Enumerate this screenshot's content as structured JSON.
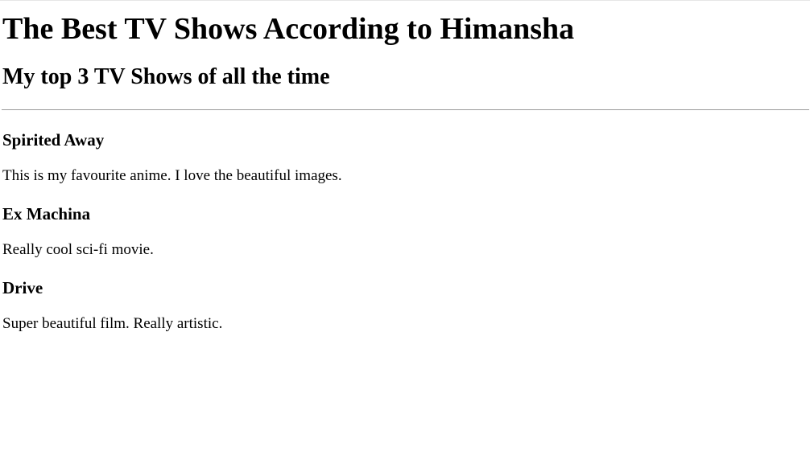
{
  "page": {
    "title": "The Best TV Shows According to Himansha",
    "subtitle": "My top 3 TV Shows of all the time"
  },
  "shows": [
    {
      "title": "Spirited Away",
      "description": "This is my favourite anime. I love the beautiful images."
    },
    {
      "title": "Ex Machina",
      "description": "Really cool sci-fi movie."
    },
    {
      "title": "Drive",
      "description": "Super beautiful film. Really artistic."
    }
  ]
}
